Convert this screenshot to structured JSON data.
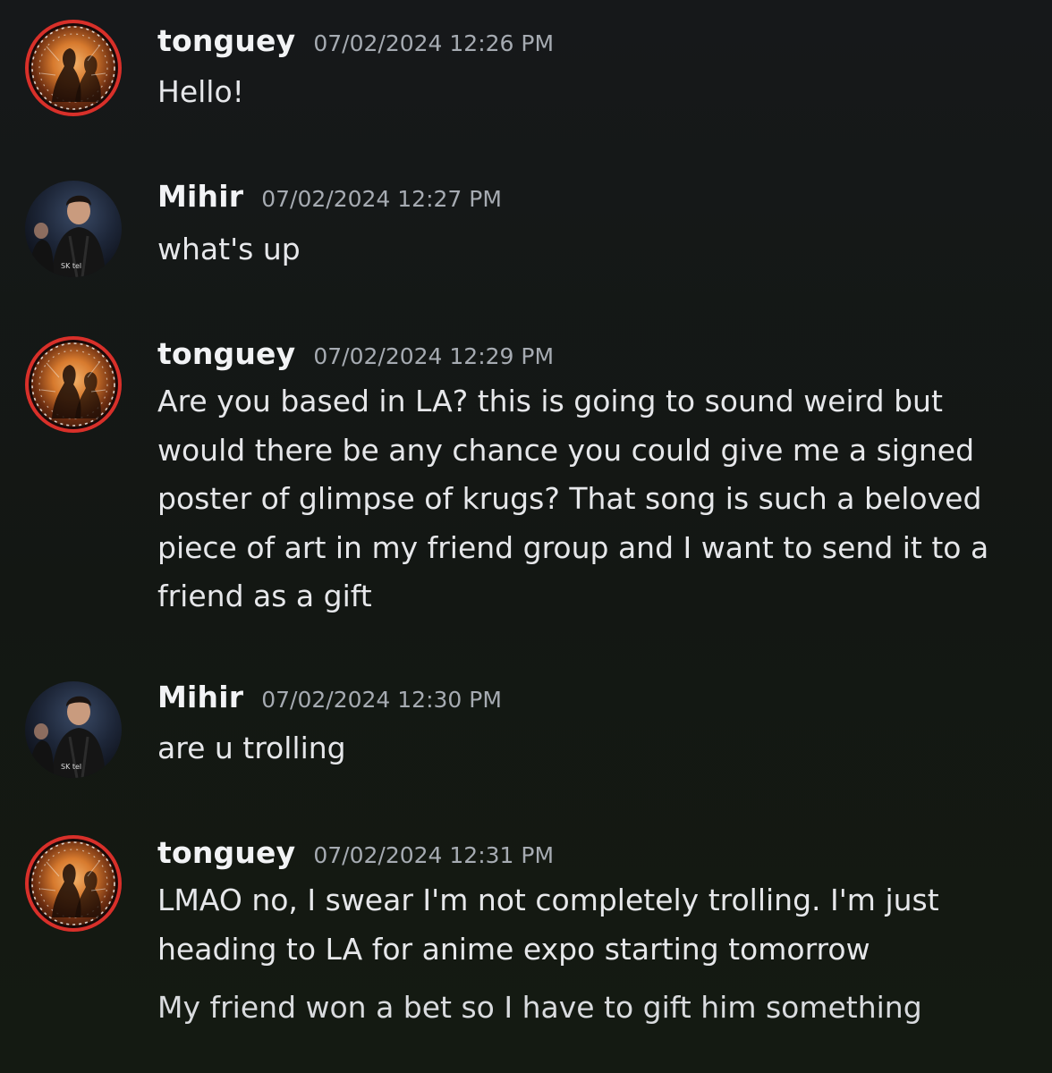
{
  "messages": [
    {
      "author": "tonguey",
      "avatar_icon": "fire-portrait-avatar",
      "timestamp": "07/02/2024 12:26 PM",
      "lines": [
        "Hello!"
      ]
    },
    {
      "author": "Mihir",
      "avatar_icon": "player-photo-avatar",
      "timestamp": "07/02/2024 12:27 PM",
      "lines": [
        "what's up"
      ]
    },
    {
      "author": "tonguey",
      "avatar_icon": "fire-portrait-avatar",
      "timestamp": "07/02/2024 12:29 PM",
      "lines": [
        "Are you based in LA? this is going to sound weird but would there be any chance you could give me a signed poster of glimpse of krugs? That song is such a beloved piece of art in my friend group and I want to send it to a friend as a gift"
      ]
    },
    {
      "author": "Mihir",
      "avatar_icon": "player-photo-avatar",
      "timestamp": "07/02/2024 12:30 PM",
      "lines": [
        "are u trolling"
      ]
    },
    {
      "author": "tonguey",
      "avatar_icon": "fire-portrait-avatar",
      "timestamp": "07/02/2024 12:31 PM",
      "lines": [
        "LMAO no, I swear I'm not completely trolling. I'm just heading to LA for anime expo starting tomorrow",
        "My friend won a bet so I have to gift him something"
      ]
    }
  ]
}
